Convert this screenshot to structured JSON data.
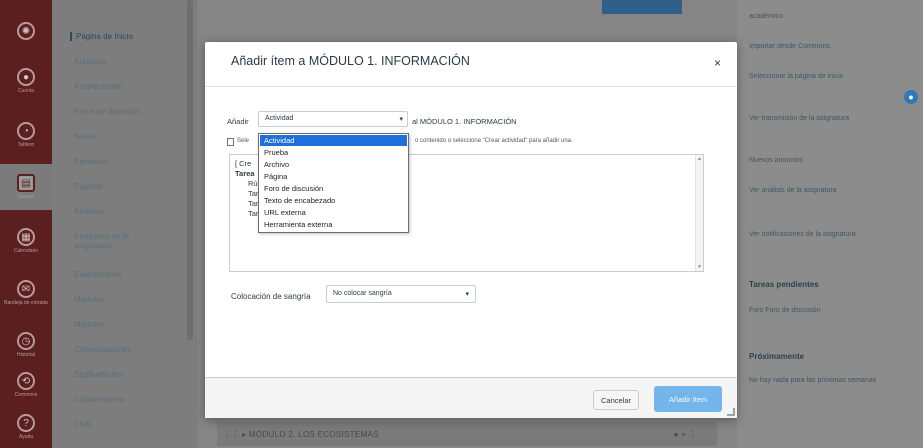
{
  "modal": {
    "title": "Añadir ítem a MÓDULO 1. INFORMACIÓN",
    "close_glyph": "×",
    "add_label": "Añadir",
    "type_select_value": "Actividad",
    "to_module": "al MÓDULO 1. INFORMACIÓN",
    "hint_left": "Sele",
    "hint_right": "o contenido o seleccione \"Crear actividad\" para añadir una.",
    "list_lines": [
      "[ Cre",
      "Tarea",
      "Rú",
      "Tar",
      "Tar",
      "Tar"
    ],
    "dropdown_options": [
      "Actividad",
      "Prueba",
      "Archivo",
      "Página",
      "Foro de discusión",
      "Texto de encabezado",
      "URL externa",
      "Herramienta externa"
    ],
    "dropdown_selected": "Actividad",
    "indent_label": "Colocación de sangría",
    "indent_value": "No colocar sangría",
    "cancel": "Cancelar",
    "add_button": "Añadir ítem"
  },
  "course_nav": [
    "Página de Inicio",
    "Anuncios",
    "Asignaciones",
    "Foros de discusión",
    "Notas",
    "Personas",
    "Páginas",
    "Archivos",
    "Programa de la asignatura",
    "Evaluaciones",
    "Módulos",
    "Módulos",
    "Conversaciones",
    "BigBlueButton",
    "Collaborations",
    "Chat"
  ],
  "global_nav": [
    "Cuenta",
    "Tablero",
    "Cursos",
    "Calendario",
    "Bandeja de entrada",
    "Historial",
    "Commons",
    "Ayuda"
  ],
  "main": {
    "module_row": "⋮⋮  ▸ MÓDULO 2. LOS ECOSISTEMAS",
    "module_row_dots": "●  +  ⋮"
  },
  "right_sidebar": {
    "items": [
      "académico",
      "Importar desde Commons",
      "Seleccionar la página de inicio",
      "Ver transmisión de la asignatura",
      "Nuevos anuncios",
      "Ver análisis de la asignatura",
      "Ver notificaciones de la asignatura"
    ],
    "todo_head": "Tareas pendientes",
    "todo_item": "Foro Foro de discusión",
    "upcoming_head": "Próximamente",
    "upcoming_item": "No hay nada para las próximas semanas"
  }
}
